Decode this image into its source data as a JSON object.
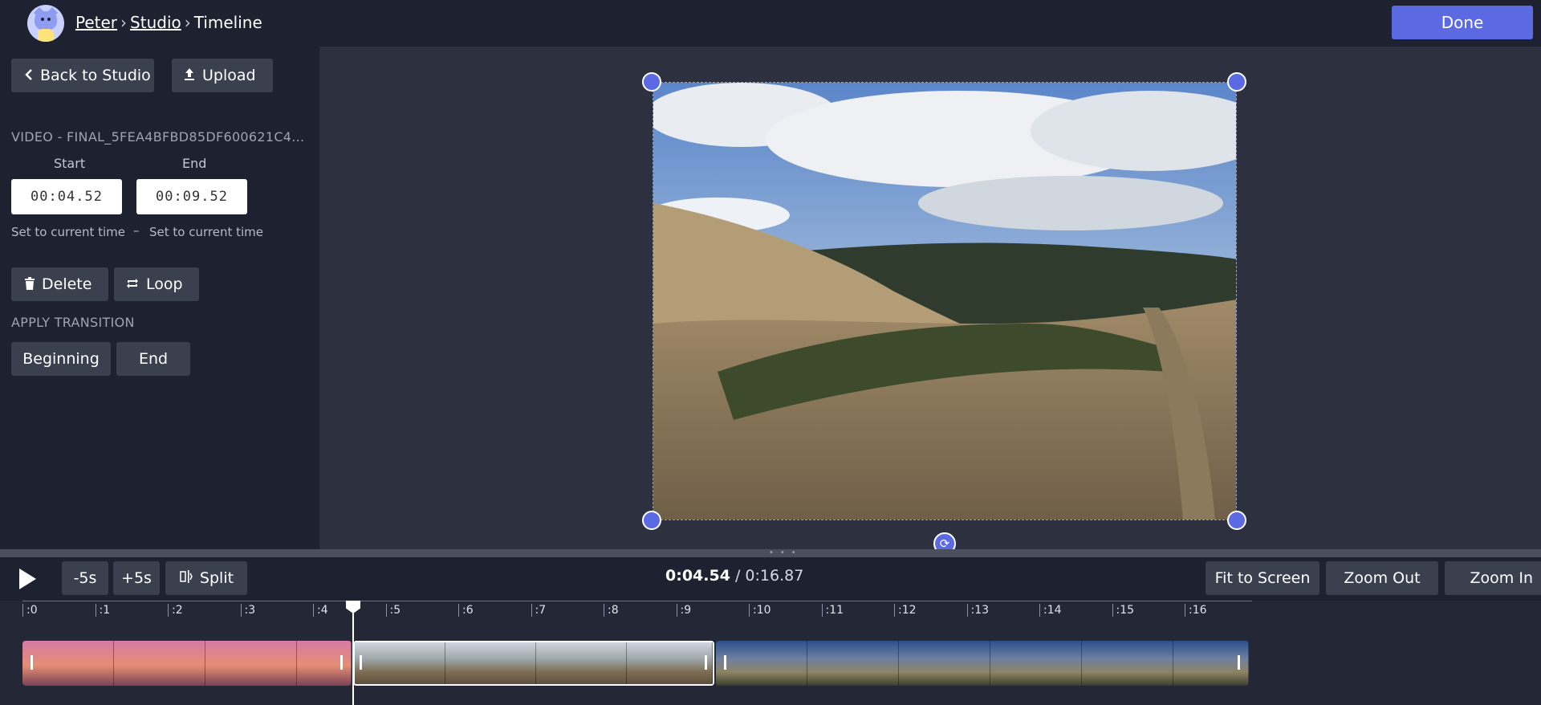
{
  "header": {
    "breadcrumb": [
      {
        "label": "Peter",
        "link": true
      },
      {
        "label": "Studio",
        "link": true
      },
      {
        "label": "Timeline",
        "link": false
      }
    ],
    "separator": "›",
    "done_label": "Done"
  },
  "sidebar": {
    "back_label": "Back to Studio",
    "upload_label": "Upload",
    "clip_name": "VIDEO - FINAL_5FEA4BFBD85DF600621C4...",
    "start_label": "Start",
    "end_label": "End",
    "start_value": "00:04.52",
    "end_value": "00:09.52",
    "set_current_start": "Set to current time",
    "set_current_dash": "–",
    "set_current_end": "Set to current time",
    "delete_label": "Delete",
    "loop_label": "Loop",
    "transition_heading": "APPLY TRANSITION",
    "beginning_label": "Beginning",
    "transition_end_label": "End"
  },
  "controls": {
    "minus5_label": "-5s",
    "plus5_label": "+5s",
    "split_label": "Split",
    "current_time": "0:04.54",
    "time_separator": " / ",
    "total_time": "0:16.87",
    "fit_label": "Fit to Screen",
    "zoom_out_label": "Zoom Out",
    "zoom_in_label": "Zoom In"
  },
  "ruler": {
    "ticks": [
      ":0",
      ":1",
      ":2",
      ":3",
      ":4",
      ":5",
      ":6",
      ":7",
      ":8",
      ":9",
      ":10",
      ":11",
      ":12",
      ":13",
      ":14",
      ":15",
      ":16"
    ]
  },
  "colors": {
    "accent": "#5b6ae3",
    "panel": "#1d2130",
    "button": "#3b404f",
    "canvas": "#2d313f"
  },
  "icons": {
    "back": "chevron-left-icon",
    "upload": "upload-icon",
    "delete": "trash-icon",
    "loop": "loop-icon",
    "split": "split-icon",
    "play": "play-icon",
    "rotate": "rotate-icon"
  }
}
